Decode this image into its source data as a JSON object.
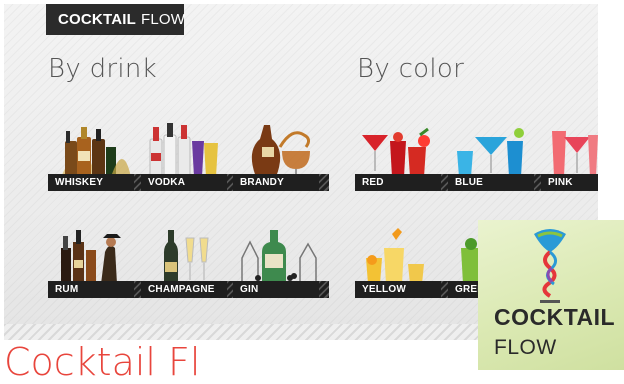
{
  "app": {
    "brand_bold": "COCKTAIL",
    "brand_light": "FLOW"
  },
  "sections": {
    "by_drink": "By drink",
    "by_color": "By color"
  },
  "drink_tiles": [
    "WHISKEY",
    "VODKA",
    "BRANDY",
    "RUM",
    "CHAMPAGNE",
    "GIN"
  ],
  "color_tiles": [
    "RED",
    "BLUE",
    "PINK",
    "YELLOW",
    "GREE"
  ],
  "logo": {
    "line1": "COCKTAIL",
    "line2": "FLOW"
  },
  "page_heading": "Cocktail Fl",
  "colors": {
    "accent": "#e8453c",
    "tile_label_bg": "#1f1f1f",
    "brand_tab_bg": "#2b2b2b"
  }
}
